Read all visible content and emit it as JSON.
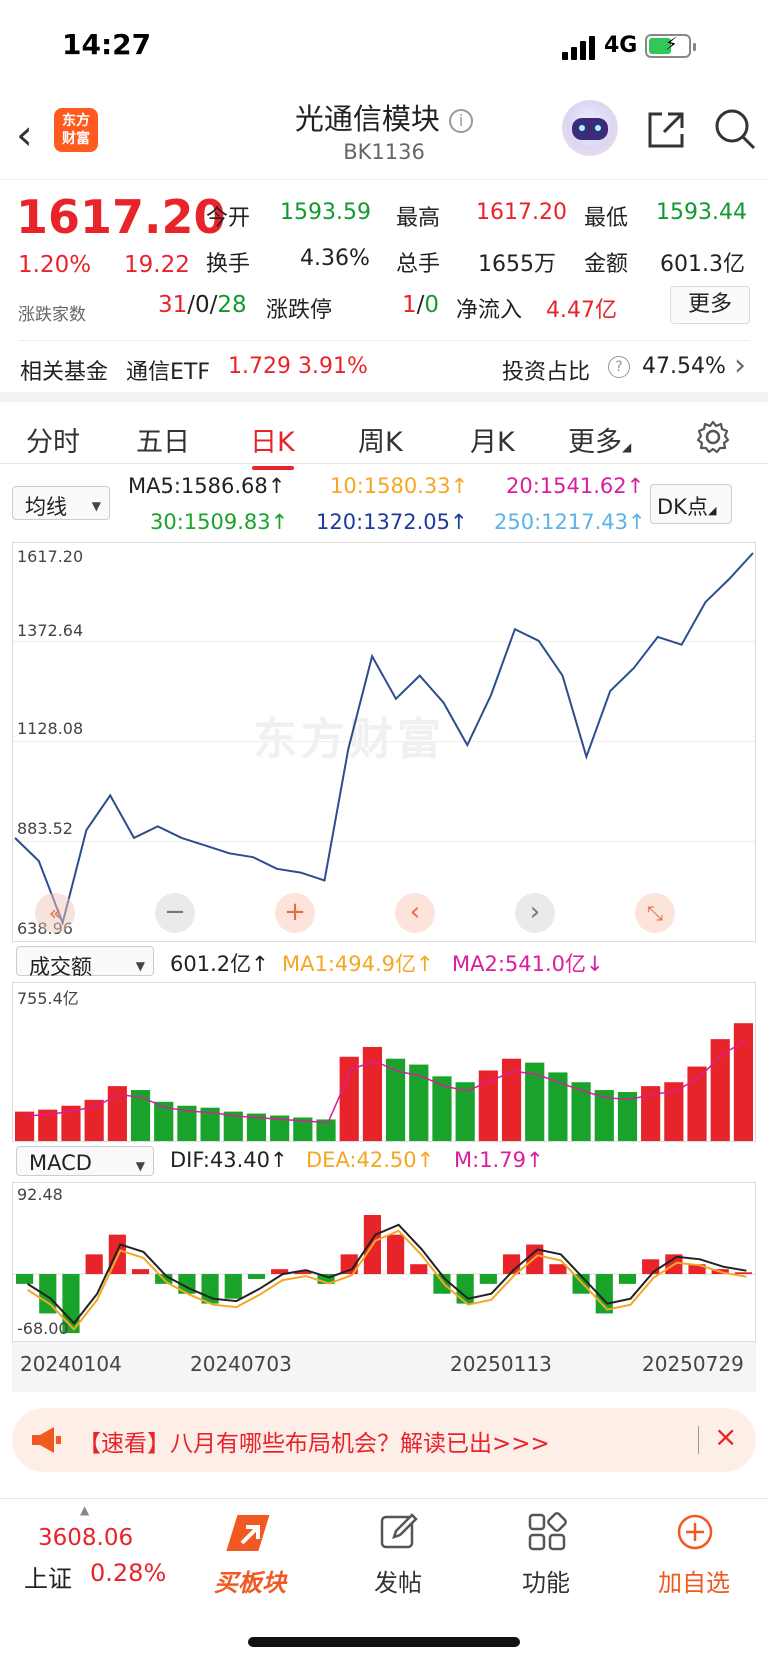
{
  "status_bar": {
    "time": "14:27",
    "network": "4G"
  },
  "header": {
    "logo_text_line1": "东方",
    "logo_text_line2": "财富",
    "title": "光通信模块",
    "code": "BK1136"
  },
  "quote": {
    "price": "1617.20",
    "change_pct": "1.20%",
    "change": "19.22",
    "adv_dec_label": "涨跌家数",
    "adv": "31",
    "flat": "0",
    "dec": "28",
    "limit_label": "涨跌停",
    "limit_up": "1",
    "limit_down": "0",
    "fields": {
      "open_label": "今开",
      "open": "1593.59",
      "high_label": "最高",
      "high": "1617.20",
      "low_label": "最低",
      "low": "1593.44",
      "turnover_label": "换手",
      "turnover": "4.36%",
      "volume_label": "总手",
      "volume": "1655万",
      "amount_label": "金额",
      "amount": "601.3亿",
      "inflow_label": "净流入",
      "inflow": "4.47亿"
    },
    "more_button": "更多"
  },
  "fund_row": {
    "label": "相关基金",
    "fund_name": "通信ETF",
    "fund_price": "1.729",
    "fund_pct": "3.91%",
    "ratio_label": "投资占比",
    "ratio_value": "47.54%"
  },
  "tabs": [
    {
      "label": "分时"
    },
    {
      "label": "五日"
    },
    {
      "label": "日K"
    },
    {
      "label": "周K"
    },
    {
      "label": "月K"
    },
    {
      "label": "更多"
    }
  ],
  "ma_row": {
    "selector": "均线",
    "ma5": "MA5:1586.68↑",
    "ma10": "10:1580.33↑",
    "ma20": "20:1541.62↑",
    "ma30": "30:1509.83↑",
    "ma120": "120:1372.05↑",
    "ma250": "250:1217.43↑",
    "dk_button": "DK点",
    "colors": {
      "ma5": "#222222",
      "ma10": "#f5a623",
      "ma20": "#d81e9c",
      "ma30": "#1aa32a",
      "ma120": "#1d3a9e",
      "ma250": "#5ab3ea"
    }
  },
  "price_axis": {
    "y1": "1617.20",
    "y2": "1372.64",
    "y3": "1128.08",
    "y4": "883.52",
    "y5": "638.96"
  },
  "chart_controls": [
    "rewind-icon",
    "zoom-out-icon",
    "zoom-in-icon",
    "prev-icon",
    "next-icon",
    "fullscreen-icon"
  ],
  "watermark": "东方财富",
  "volume_panel": {
    "selector": "成交额",
    "value": "601.2亿↑",
    "ma1": "MA1:494.9亿↑",
    "ma2": "MA2:541.0亿↓",
    "axis_max": "755.4亿"
  },
  "macd_panel": {
    "selector": "MACD",
    "dif": "DIF:43.40↑",
    "dea": "DEA:42.50↑",
    "m": "M:1.79↑",
    "axis_max": "92.48",
    "axis_min": "-68.00"
  },
  "dates": [
    "20240104",
    "20240703",
    "20250113",
    "20250729"
  ],
  "banner": {
    "text": "【速看】八月有哪些布局机会？解读已出>>>"
  },
  "bottom_bar": {
    "index_value": "3608.06",
    "index_name": "上证",
    "index_pct": "0.28%",
    "buy_block": "买板块",
    "post": "发帖",
    "features": "功能",
    "add_watch": "加自选"
  },
  "chart_data": [
    {
      "type": "line",
      "title": "",
      "xlabel": "",
      "ylabel": "",
      "x": [
        "20240104",
        "20240703",
        "20250113",
        "20250729"
      ],
      "ylim": [
        638.96,
        1617.2
      ],
      "yticks": [
        1617.2,
        1372.64,
        1128.08,
        883.52,
        638.96
      ],
      "series": [
        {
          "values": [
            880,
            820,
            660,
            900,
            990,
            880,
            910,
            880,
            860,
            840,
            830,
            800,
            790,
            770,
            1110,
            1350,
            1240,
            1300,
            1230,
            1120,
            1250,
            1420,
            1390,
            1300,
            1090,
            1260,
            1320,
            1400,
            1380,
            1490,
            1550,
            1617.2
          ]
        }
      ]
    },
    {
      "type": "bar",
      "title": "",
      "ylim": [
        0,
        755.4
      ],
      "series": [
        {
          "name": "成交额",
          "values": [
            150,
            160,
            180,
            210,
            280,
            260,
            200,
            180,
            170,
            150,
            140,
            130,
            120,
            110,
            430,
            480,
            420,
            390,
            330,
            300,
            360,
            420,
            400,
            350,
            300,
            260,
            250,
            280,
            300,
            380,
            520,
            601.2
          ]
        }
      ]
    },
    {
      "type": "bar",
      "title": "",
      "ylim": [
        -68.0,
        92.48
      ],
      "series": [
        {
          "name": "M",
          "values": [
            -10,
            -40,
            -60,
            20,
            40,
            5,
            -10,
            -20,
            -30,
            -25,
            -5,
            5,
            3,
            -10,
            20,
            60,
            40,
            10,
            -20,
            -30,
            -10,
            20,
            30,
            10,
            -20,
            -40,
            -10,
            15,
            20,
            10,
            5,
            1.79
          ]
        }
      ]
    }
  ]
}
